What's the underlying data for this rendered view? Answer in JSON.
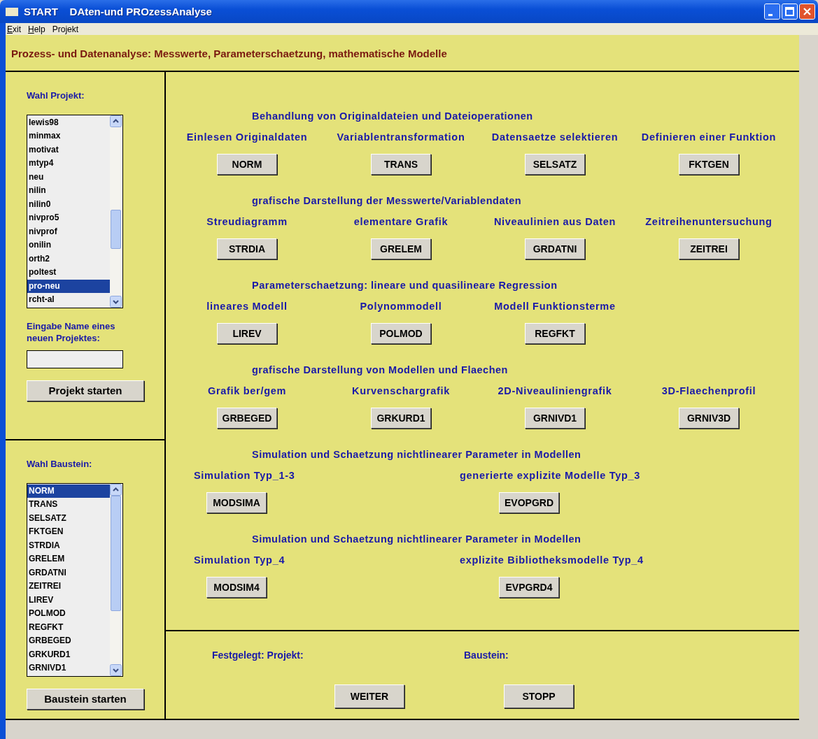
{
  "window": {
    "title": "START    DAten-und PROzessAnalyse"
  },
  "menu": [
    {
      "label": "Exit",
      "mnemonic": true
    },
    {
      "label": "Help",
      "mnemonic": true
    },
    {
      "label": "Projekt",
      "mnemonic": false
    }
  ],
  "header": "Prozess- und Datenanalyse: Messwerte, Parameterschaetzung, mathematische Modelle",
  "project_panel": {
    "title": "Wahl Projekt:",
    "items": [
      {
        "label": "lewis98",
        "selected": false
      },
      {
        "label": "minmax",
        "selected": false
      },
      {
        "label": "motivat",
        "selected": false
      },
      {
        "label": "mtyp4",
        "selected": false
      },
      {
        "label": "neu",
        "selected": false
      },
      {
        "label": "nilin",
        "selected": false
      },
      {
        "label": "nilin0",
        "selected": false
      },
      {
        "label": "nivpro5",
        "selected": false
      },
      {
        "label": "nivprof",
        "selected": false
      },
      {
        "label": "onilin",
        "selected": false
      },
      {
        "label": "orth2",
        "selected": false
      },
      {
        "label": "poltest",
        "selected": false
      },
      {
        "label": "pro-neu",
        "selected": true
      },
      {
        "label": "rcht-al",
        "selected": false
      }
    ],
    "input_label": "Eingabe Name eines neuen Projektes:",
    "button": "Projekt starten"
  },
  "module_panel": {
    "title": "Wahl Baustein:",
    "items": [
      {
        "label": "NORM",
        "selected": true
      },
      {
        "label": "TRANS",
        "selected": false
      },
      {
        "label": "SELSATZ",
        "selected": false
      },
      {
        "label": "FKTGEN",
        "selected": false
      },
      {
        "label": "STRDIA",
        "selected": false
      },
      {
        "label": "GRELEM",
        "selected": false
      },
      {
        "label": "GRDATNI",
        "selected": false
      },
      {
        "label": "ZEITREI",
        "selected": false
      },
      {
        "label": "LIREV",
        "selected": false
      },
      {
        "label": "POLMOD",
        "selected": false
      },
      {
        "label": "REGFKT",
        "selected": false
      },
      {
        "label": "GRBEGED",
        "selected": false
      },
      {
        "label": "GRKURD1",
        "selected": false
      },
      {
        "label": "GRNIVD1",
        "selected": false
      }
    ],
    "button": "Baustein starten"
  },
  "groups": [
    {
      "title": "Behandlung von Originaldateien und Dateioperationen",
      "kind": "four",
      "items": [
        {
          "label": "Einlesen Originaldaten",
          "button": "NORM"
        },
        {
          "label": "Variablentransformation",
          "button": "TRANS"
        },
        {
          "label": "Datensaetze selektieren",
          "button": "SELSATZ"
        },
        {
          "label": "Definieren einer Funktion",
          "button": "FKTGEN"
        }
      ]
    },
    {
      "title": "grafische Darstellung der Messwerte/Variablendaten",
      "kind": "four",
      "items": [
        {
          "label": "Streudiagramm",
          "button": "STRDIA"
        },
        {
          "label": "elementare Grafik",
          "button": "GRELEM"
        },
        {
          "label": "Niveaulinien aus Daten",
          "button": "GRDATNI"
        },
        {
          "label": "Zeitreihenuntersuchung",
          "button": "ZEITREI"
        }
      ]
    },
    {
      "title": "Parameterschaetzung: lineare und quasilineare Regression",
      "kind": "four",
      "items": [
        {
          "label": "lineares Modell",
          "button": "LIREV"
        },
        {
          "label": "Polynommodell",
          "button": "POLMOD"
        },
        {
          "label": "Modell Funktionsterme",
          "button": "REGFKT"
        }
      ]
    },
    {
      "title": "grafische Darstellung von Modellen und Flaechen",
      "kind": "four",
      "items": [
        {
          "label": "Grafik ber/gem",
          "button": "GRBEGED"
        },
        {
          "label": "Kurvenschargrafik",
          "button": "GRKURD1"
        },
        {
          "label": "2D-Niveauliniengrafik",
          "button": "GRNIVD1"
        },
        {
          "label": "3D-Flaechenprofil",
          "button": "GRNIV3D"
        }
      ]
    },
    {
      "title": "Simulation und Schaetzung nichtlinearer Parameter in Modellen",
      "kind": "two",
      "items": [
        {
          "label": "Simulation Typ_1-3",
          "button": "MODSIMA"
        },
        {
          "label": "generierte explizite Modelle Typ_3",
          "button": "EVOPGRD"
        }
      ]
    },
    {
      "title": "Simulation und Schaetzung nichtlinearer Parameter in Modellen",
      "kind": "two",
      "items": [
        {
          "label": "Simulation Typ_4",
          "button": "MODSIM4"
        },
        {
          "label": "explizite Bibliotheksmodelle Typ_4",
          "button": "EVPGRD4"
        }
      ]
    }
  ],
  "footer": {
    "project_label": "Festgelegt: Projekt:",
    "module_label": "Baustein:",
    "buttons": [
      "WEITER",
      "STOPP"
    ]
  }
}
